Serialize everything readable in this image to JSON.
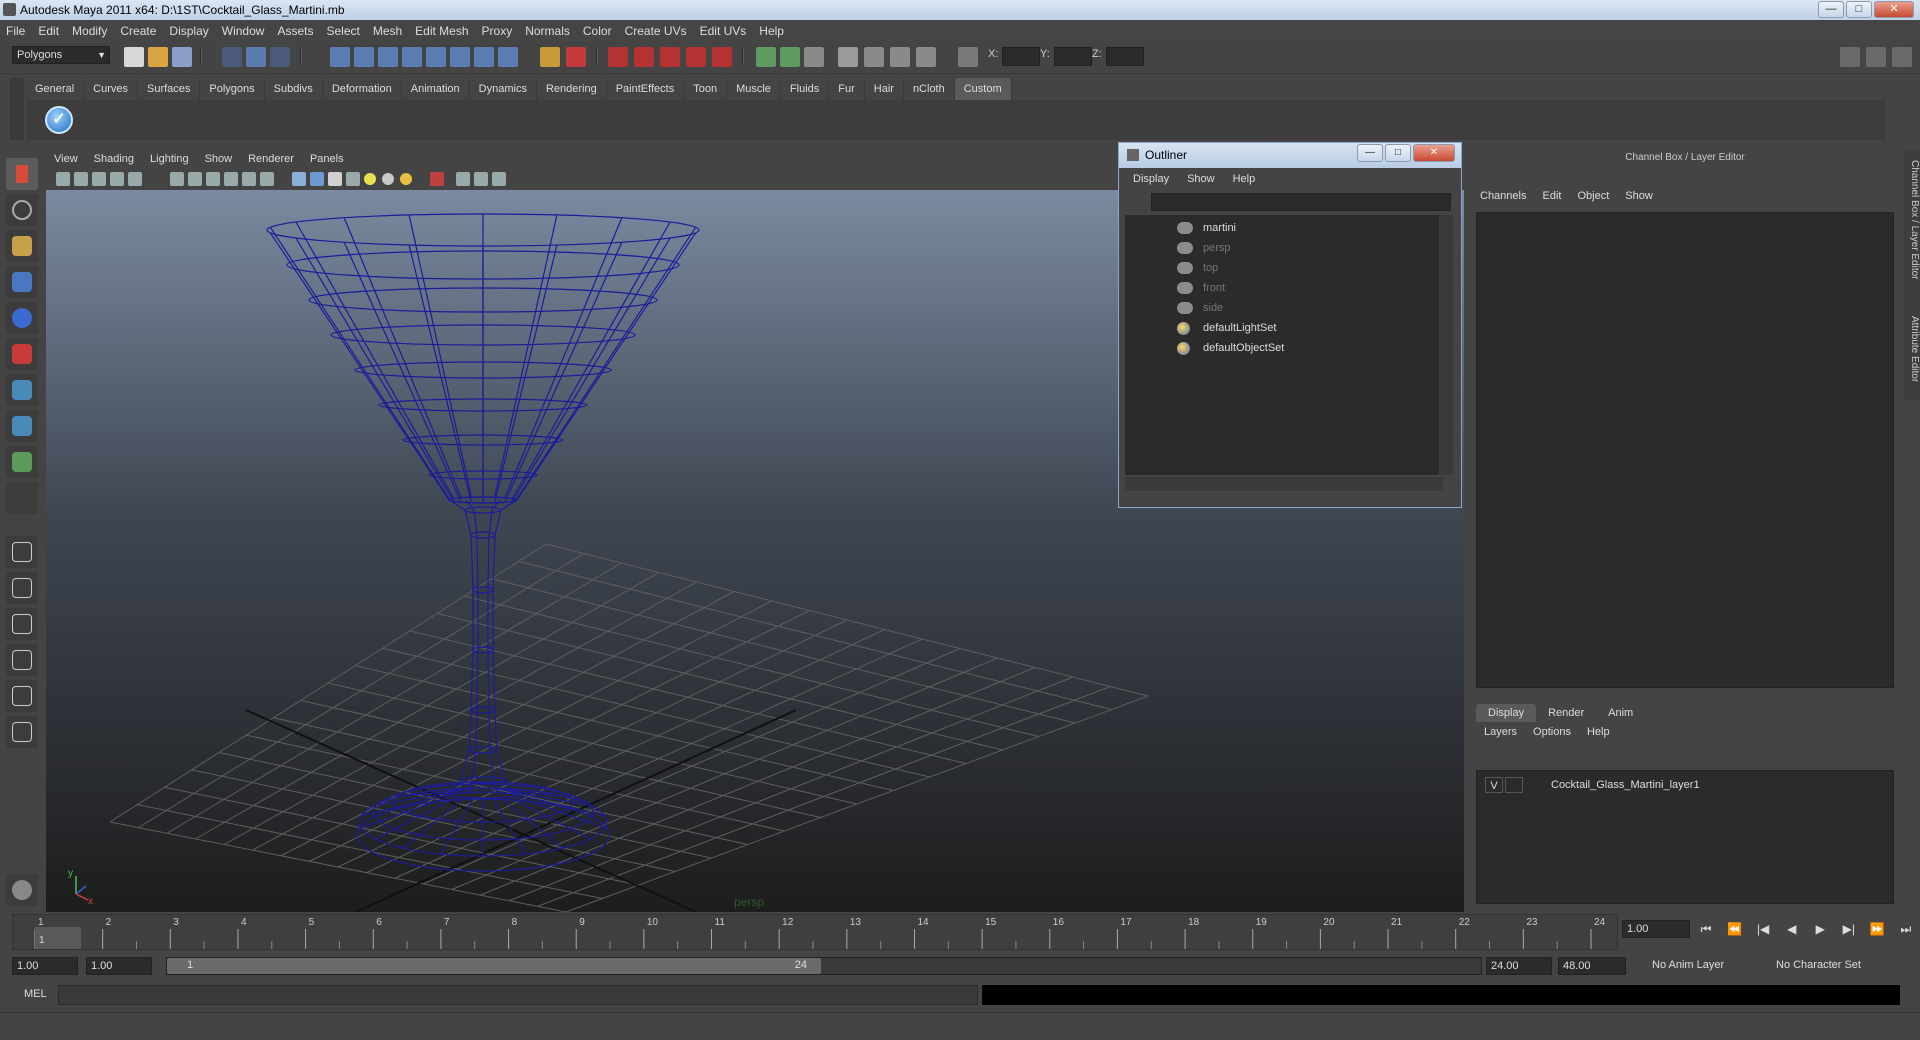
{
  "window": {
    "title": "Autodesk Maya 2011 x64: D:\\1ST\\Cocktail_Glass_Martini.mb",
    "min": "—",
    "max": "□",
    "close": "✕"
  },
  "menus": [
    "File",
    "Edit",
    "Modify",
    "Create",
    "Display",
    "Window",
    "Assets",
    "Select",
    "Mesh",
    "Edit Mesh",
    "Proxy",
    "Normals",
    "Color",
    "Create UVs",
    "Edit UVs",
    "Help"
  ],
  "toolbar": {
    "mode": "Polygons",
    "x_label": "X:",
    "y_label": "Y:",
    "z_label": "Z:"
  },
  "shelf": {
    "tabs": [
      "General",
      "Curves",
      "Surfaces",
      "Polygons",
      "Subdivs",
      "Deformation",
      "Animation",
      "Dynamics",
      "Rendering",
      "PaintEffects",
      "Toon",
      "Muscle",
      "Fluids",
      "Fur",
      "Hair",
      "nCloth",
      "Custom"
    ],
    "active": "Custom"
  },
  "viewport": {
    "menus": [
      "View",
      "Shading",
      "Lighting",
      "Show",
      "Renderer",
      "Panels"
    ],
    "camera_label": "persp",
    "axis_x": "x",
    "axis_y": "y"
  },
  "outliner": {
    "title": "Outliner",
    "menus": [
      "Display",
      "Show",
      "Help"
    ],
    "items": [
      {
        "label": "martini",
        "kind": "mesh",
        "dim": false
      },
      {
        "label": "persp",
        "kind": "camera",
        "dim": true
      },
      {
        "label": "top",
        "kind": "camera",
        "dim": true
      },
      {
        "label": "front",
        "kind": "camera",
        "dim": true
      },
      {
        "label": "side",
        "kind": "camera",
        "dim": true
      },
      {
        "label": "defaultLightSet",
        "kind": "set",
        "dim": false
      },
      {
        "label": "defaultObjectSet",
        "kind": "set",
        "dim": false
      }
    ]
  },
  "channelbox": {
    "title": "Channel Box / Layer Editor",
    "menus": [
      "Channels",
      "Edit",
      "Object",
      "Show"
    ],
    "layer_tabs": [
      "Display",
      "Render",
      "Anim"
    ],
    "layer_menus": [
      "Layers",
      "Options",
      "Help"
    ],
    "layer": {
      "visible": "V",
      "name": "Cocktail_Glass_Martini_layer1"
    }
  },
  "side_tabs": [
    "Channel Box / Layer Editor",
    "Attribute Editor"
  ],
  "timeline": {
    "ticks": [
      "1",
      "2",
      "3",
      "4",
      "5",
      "6",
      "7",
      "8",
      "9",
      "10",
      "11",
      "12",
      "13",
      "14",
      "15",
      "16",
      "17",
      "18",
      "19",
      "20",
      "21",
      "22",
      "23",
      "24"
    ],
    "current_marker": "1",
    "current_frame": "1.00",
    "playback_glyphs": [
      "⏮",
      "⏪",
      "|◀",
      "◀",
      "▶",
      "▶|",
      "⏩",
      "⏭"
    ]
  },
  "range": {
    "start": "1.00",
    "playback_start": "1.00",
    "slider_start": "1",
    "slider_end": "24",
    "playback_end": "24.00",
    "end": "48.00",
    "anim_layer": "No Anim Layer",
    "char_set": "No Character Set"
  },
  "mel": {
    "label": "MEL"
  },
  "colors": {
    "wire": "#1c1c9a",
    "grid": "#5e5e5e",
    "bg_top": "#7b8aa0",
    "bg_bottom": "#1d1d1d"
  }
}
